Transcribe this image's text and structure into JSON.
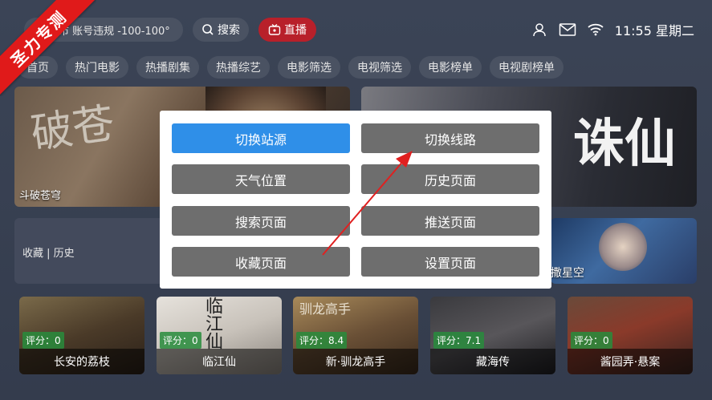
{
  "ribbon": {
    "text": "圣力专测"
  },
  "topbar": {
    "location": "京市 账号违规 -100-100°",
    "search_label": "搜索",
    "live_label": "直播",
    "time": "11:55 星期二"
  },
  "nav": {
    "tabs": [
      {
        "label": "首页"
      },
      {
        "label": "热门电影"
      },
      {
        "label": "热播剧集"
      },
      {
        "label": "热播综艺"
      },
      {
        "label": "电影筛选"
      },
      {
        "label": "电视筛选"
      },
      {
        "label": "电影榜单"
      },
      {
        "label": "电视剧榜单"
      }
    ]
  },
  "banners": {
    "left_caption": "斗破苍穹",
    "left_art": "破苍",
    "right_art": "诛仙"
  },
  "history": {
    "label": "收藏 | 历史"
  },
  "star_card": {
    "caption": "撒星空"
  },
  "posters": [
    {
      "rating": "评分：0",
      "title": "长安的荔枝"
    },
    {
      "rating": "评分：0",
      "title": "临江仙",
      "art": "临江仙"
    },
    {
      "rating": "评分：8.4",
      "title": "新·驯龙高手",
      "art": "驯龙高手"
    },
    {
      "rating": "评分：7.1",
      "title": "藏海传"
    },
    {
      "rating": "评分：0",
      "title": "酱园弄·悬案"
    }
  ],
  "modal": {
    "buttons": [
      {
        "label": "切换站源",
        "active": true
      },
      {
        "label": "切换线路"
      },
      {
        "label": "天气位置"
      },
      {
        "label": "历史页面"
      },
      {
        "label": "搜索页面"
      },
      {
        "label": "推送页面"
      },
      {
        "label": "收藏页面"
      },
      {
        "label": "设置页面"
      }
    ]
  },
  "colors": {
    "accent": "#2f8fe8",
    "live": "#b8202a",
    "ribbon": "#e01a1a"
  }
}
